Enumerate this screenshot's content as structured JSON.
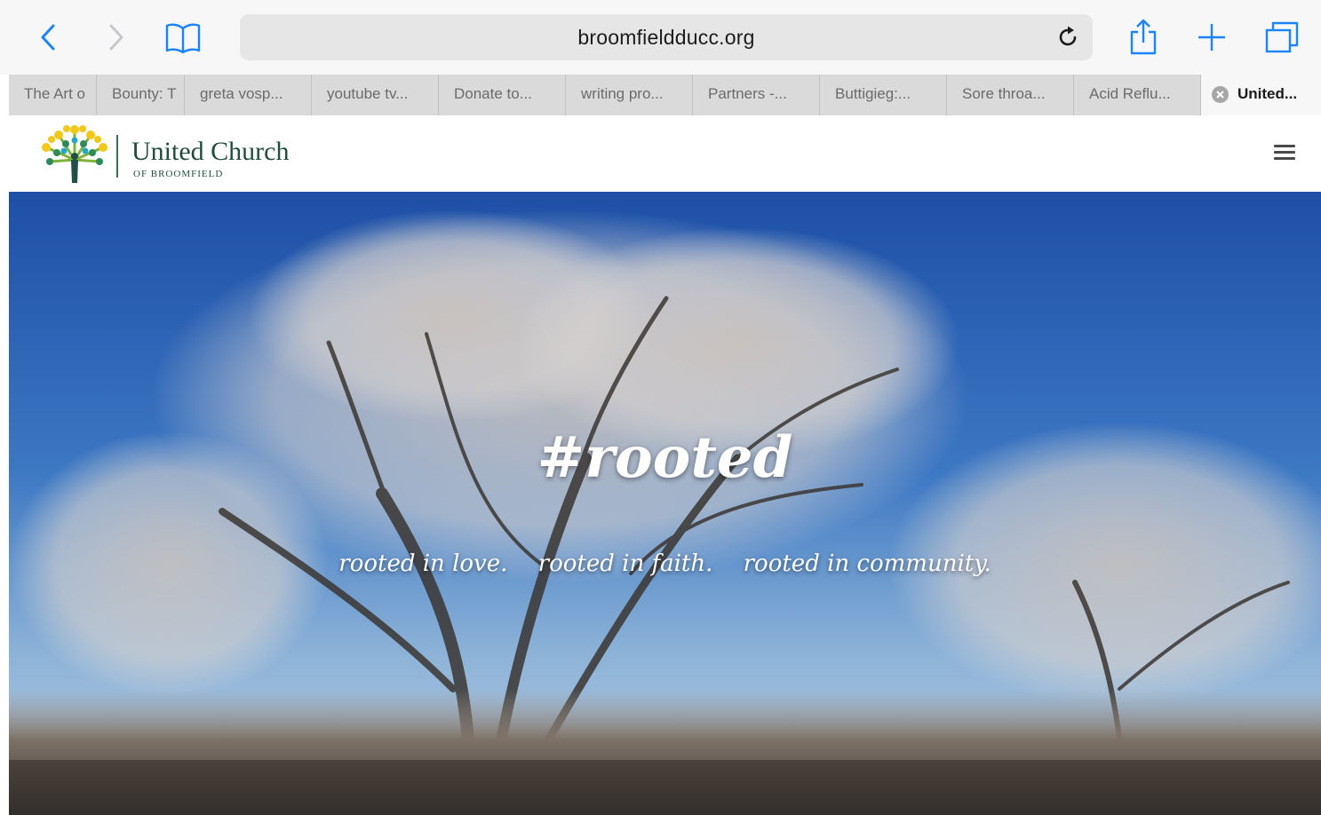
{
  "browser": {
    "address": "broomfieldducc.org",
    "icons": {
      "back": "chevron-left-icon",
      "forward": "chevron-right-icon",
      "bookmarks": "book-icon",
      "reload": "reload-icon",
      "share": "share-icon",
      "new_tab": "plus-icon",
      "tabs": "tabs-icon"
    },
    "accent_color": "#1a84ff",
    "tabs": [
      {
        "label": "The Art o"
      },
      {
        "label": "Bounty: T"
      },
      {
        "label": "greta vosp..."
      },
      {
        "label": "youtube tv..."
      },
      {
        "label": "Donate to..."
      },
      {
        "label": "writing pro..."
      },
      {
        "label": "Partners -..."
      },
      {
        "label": "Buttigieg:..."
      },
      {
        "label": "Sore throa..."
      },
      {
        "label": "Acid Reflu..."
      },
      {
        "label": "United..."
      }
    ]
  },
  "site": {
    "brand_name": "United Church",
    "brand_sub": "OF BROOMFIELD",
    "brand_color": "#214c3f",
    "menu_icon": "hamburger-menu-icon",
    "hero": {
      "title": "#rooted",
      "taglines": [
        "rooted in love.",
        "rooted in faith.",
        "rooted in community."
      ]
    }
  }
}
